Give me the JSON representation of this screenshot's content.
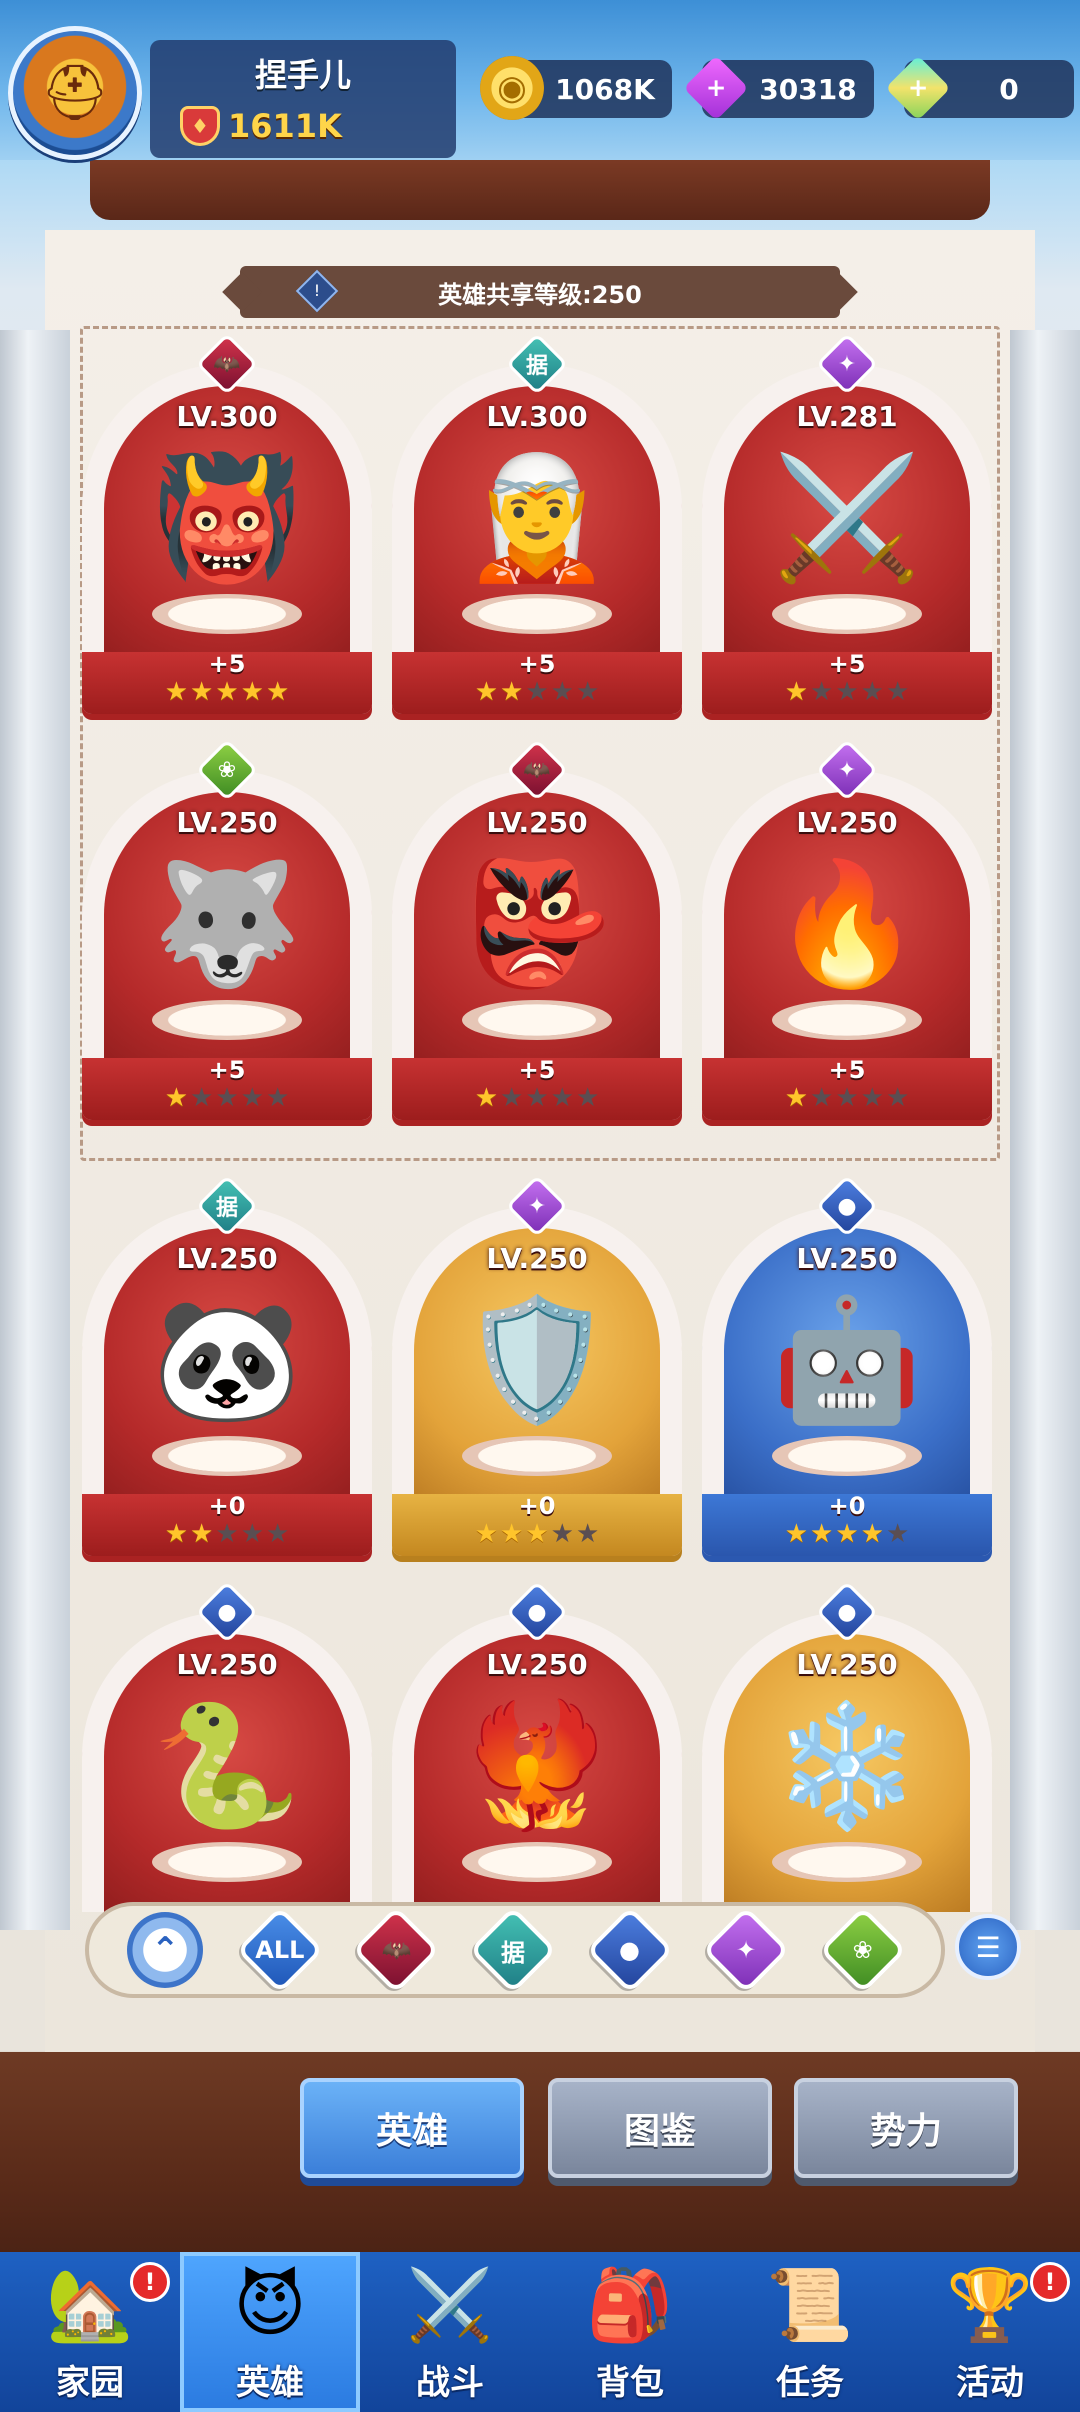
{
  "player": {
    "name": "捏手儿",
    "power": "1611K",
    "avatar_icon": "golden-knight-helmet"
  },
  "resources": [
    {
      "name": "gold",
      "value": "1068K",
      "icon": "coin-icon"
    },
    {
      "name": "purple-gem",
      "value": "30318",
      "icon": "purple-gem-plus-icon"
    },
    {
      "name": "rainbow-gem",
      "value": "0",
      "icon": "rainbow-gem-plus-icon"
    }
  ],
  "shared_level": {
    "label": "英雄共享等级:250",
    "info_icon": "exclamation-icon"
  },
  "heroes": [
    {
      "level": "LV.300",
      "bonus": "+5",
      "stars": 5,
      "faction": "demon",
      "frame": "red",
      "emoji": "👹"
    },
    {
      "level": "LV.300",
      "bonus": "+5",
      "stars": 2,
      "faction": "order",
      "frame": "red",
      "emoji": "🧝"
    },
    {
      "level": "LV.281",
      "bonus": "+5",
      "stars": 1,
      "faction": "light",
      "frame": "red",
      "emoji": "⚔️"
    },
    {
      "level": "LV.250",
      "bonus": "+5",
      "stars": 1,
      "faction": "nature",
      "frame": "red",
      "emoji": "🐺"
    },
    {
      "level": "LV.250",
      "bonus": "+5",
      "stars": 1,
      "faction": "demon",
      "frame": "red",
      "emoji": "👺"
    },
    {
      "level": "LV.250",
      "bonus": "+5",
      "stars": 1,
      "faction": "light",
      "frame": "red",
      "emoji": "🔥"
    },
    {
      "level": "LV.250",
      "bonus": "+0",
      "stars": 2,
      "faction": "order",
      "frame": "red",
      "emoji": "🐼"
    },
    {
      "level": "LV.250",
      "bonus": "+0",
      "stars": 3,
      "faction": "light",
      "frame": "gold",
      "emoji": "🛡️"
    },
    {
      "level": "LV.250",
      "bonus": "+0",
      "stars": 4,
      "faction": "dark",
      "frame": "blue",
      "emoji": "🤖"
    },
    {
      "level": "LV.250",
      "bonus": "",
      "stars": 0,
      "faction": "dark",
      "frame": "red",
      "emoji": "🐍"
    },
    {
      "level": "LV.250",
      "bonus": "",
      "stars": 0,
      "faction": "dark",
      "frame": "red",
      "emoji": "🐦‍🔥"
    },
    {
      "level": "LV.250",
      "bonus": "",
      "stars": 0,
      "faction": "dark",
      "frame": "gold",
      "emoji": "❄️"
    }
  ],
  "faction_symbols": {
    "demon": "🦇",
    "order": "据",
    "light": "✦",
    "nature": "❀",
    "dark": "●"
  },
  "filters": [
    {
      "name": "collapse",
      "icon": "up-arrow-icon",
      "label": ""
    },
    {
      "name": "all",
      "icon": "all-icon",
      "label": "ALL"
    },
    {
      "name": "demon",
      "icon": "bat-icon",
      "label": ""
    },
    {
      "name": "order",
      "icon": "order-seal-icon",
      "label": "据"
    },
    {
      "name": "dark",
      "icon": "orb-icon",
      "label": ""
    },
    {
      "name": "light",
      "icon": "wings-icon",
      "label": ""
    },
    {
      "name": "nature",
      "icon": "lotus-icon",
      "label": ""
    }
  ],
  "tabs": [
    {
      "label": "英雄",
      "active": true
    },
    {
      "label": "图鉴",
      "active": false
    },
    {
      "label": "势力",
      "active": false
    }
  ],
  "nav": [
    {
      "label": "家园",
      "icon": "house-icon",
      "emoji": "🏡",
      "badge": "!",
      "active": false
    },
    {
      "label": "英雄",
      "icon": "hero-icon",
      "emoji": "😈",
      "badge": "",
      "active": true
    },
    {
      "label": "战斗",
      "icon": "crossed-swords-icon",
      "emoji": "⚔️",
      "badge": "",
      "active": false
    },
    {
      "label": "背包",
      "icon": "backpack-icon",
      "emoji": "🎒",
      "badge": "",
      "active": false
    },
    {
      "label": "任务",
      "icon": "scroll-icon",
      "emoji": "📜",
      "badge": "",
      "active": false
    },
    {
      "label": "活动",
      "icon": "trophy-icon",
      "emoji": "🏆",
      "badge": "!",
      "active": false
    }
  ]
}
